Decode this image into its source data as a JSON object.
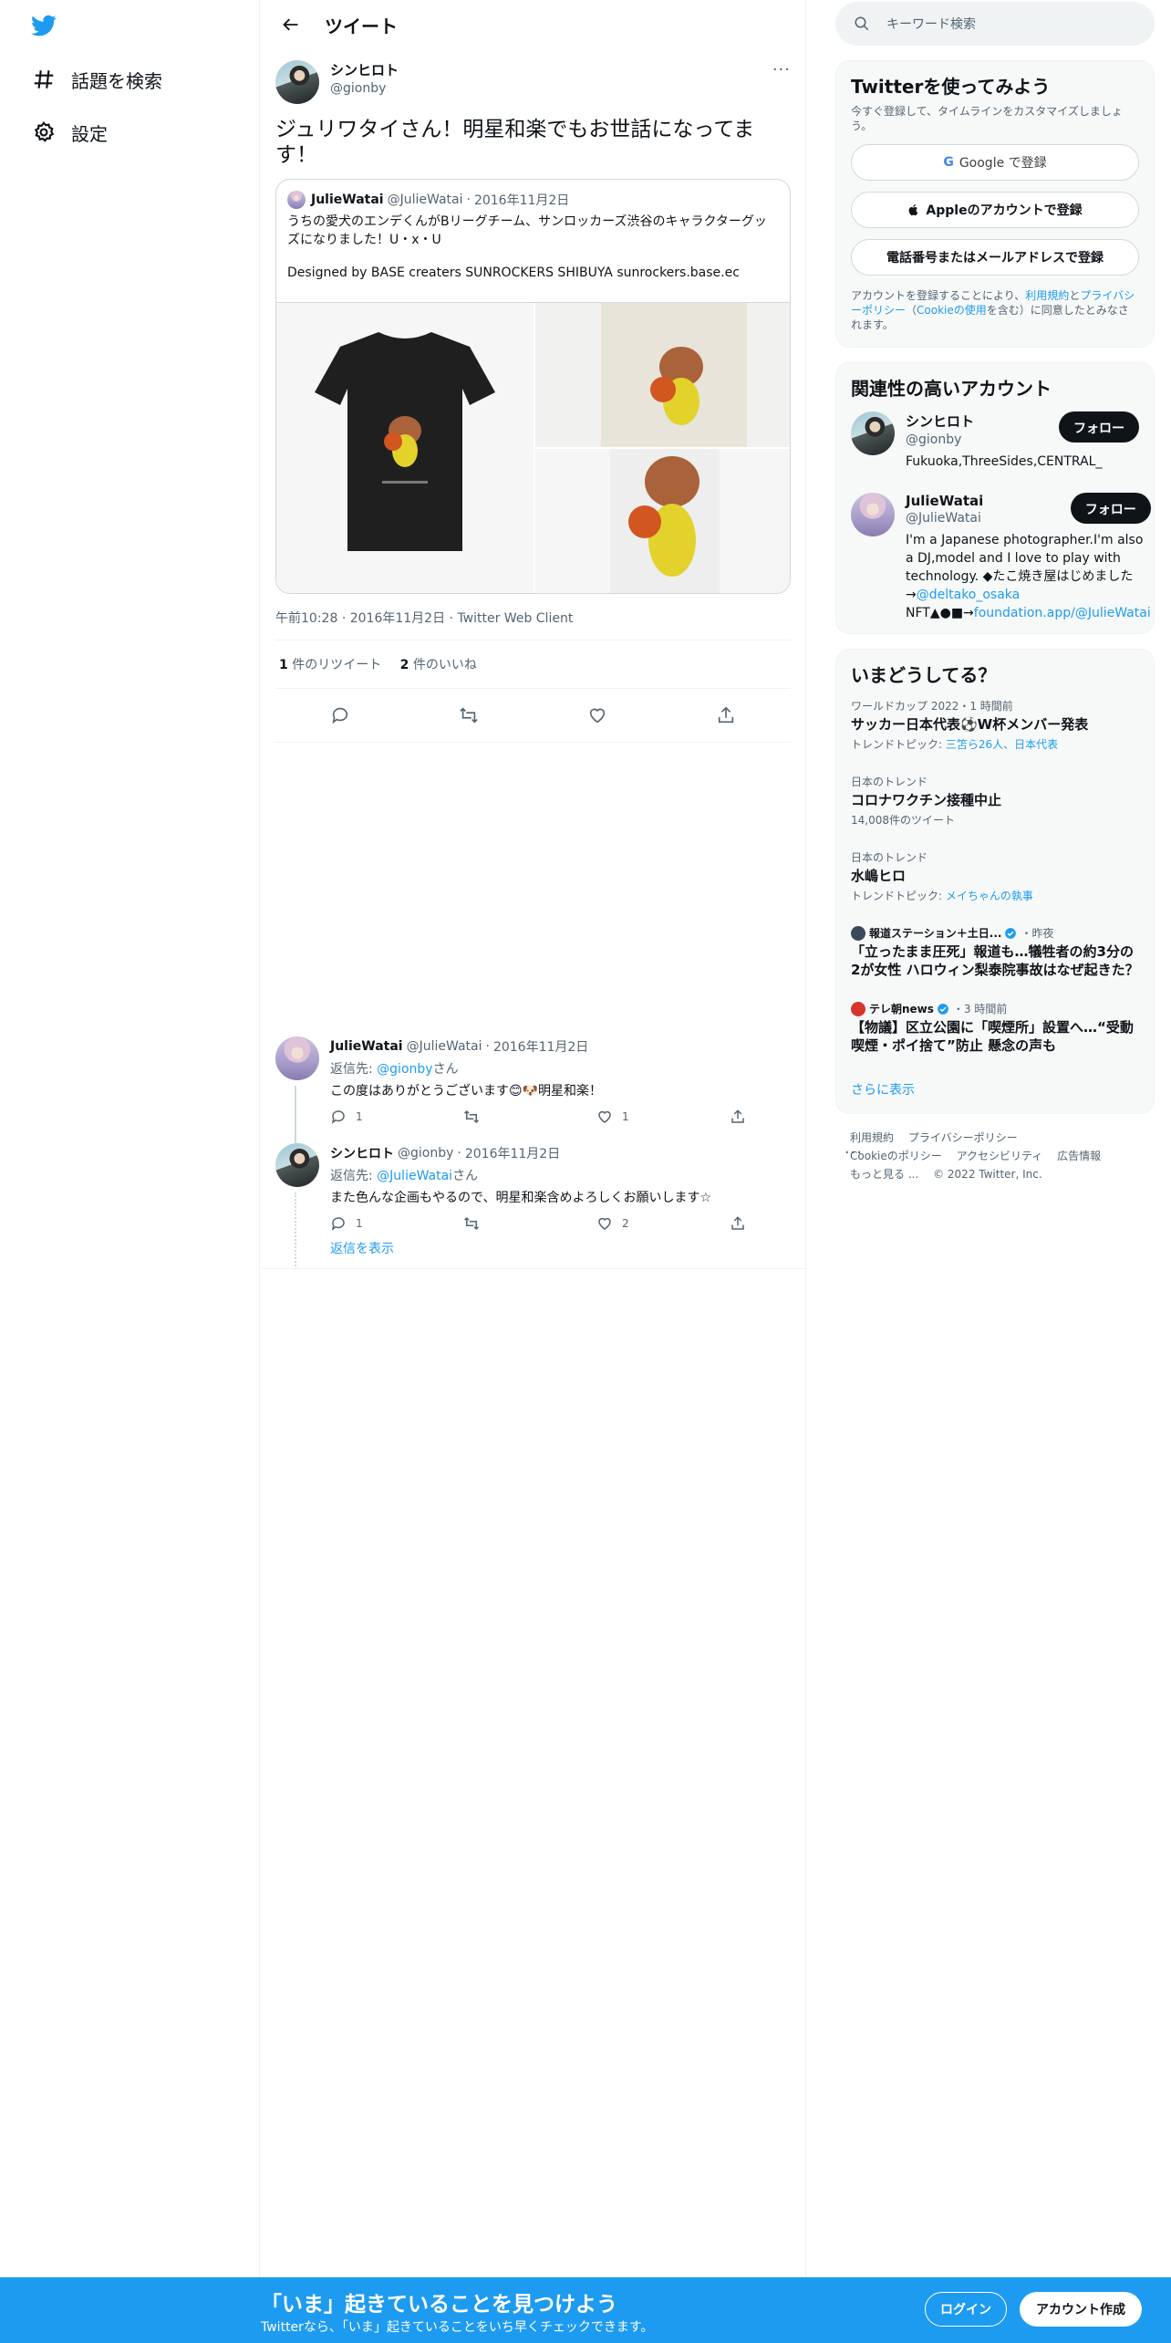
{
  "nav": {
    "explore_label": "話題を検索",
    "settings_label": "設定"
  },
  "header": {
    "title": "ツイート"
  },
  "tweet": {
    "display_name": "シンヒロト",
    "handle": "@gionby",
    "text": "ジュリワタイさん！明星和楽でもお世話になってます！",
    "quote": {
      "display_name": "JulieWatai",
      "handle": "@JulieWatai",
      "date": "2016年11月2日",
      "text_line1": "うちの愛犬のエンデくんがBリーグチーム、サンロッカーズ渋谷のキャラクターグッズになりました！U・x・U",
      "text_line2": "Designed by BASE creaters SUNROCKERS SHIBUYA sunrockers.base.ec"
    },
    "meta_time": "午前10:28",
    "meta_date": "2016年11月2日",
    "meta_client": "Twitter Web Client",
    "retweet_count": "1",
    "retweet_label": "件のリツイート",
    "like_count": "2",
    "like_label": "件のいいね"
  },
  "replies": [
    {
      "display_name": "JulieWatai",
      "handle": "@JulieWatai",
      "date": "2016年11月2日",
      "reply_to_prefix": "返信先: ",
      "reply_to_handle": "@gionby",
      "reply_to_suffix": "さん",
      "text": "この度はありがとうございます😊🐶明星和楽！",
      "reply_count": "1",
      "retweet_count": "",
      "like_count": "1"
    },
    {
      "display_name": "シンヒロト",
      "handle": "@gionby",
      "date": "2016年11月2日",
      "reply_to_prefix": "返信先: ",
      "reply_to_handle": "@JulieWatai",
      "reply_to_suffix": "さん",
      "text": "また色んな企画もやるので、明星和楽含めよろしくお願いします☆",
      "reply_count": "1",
      "retweet_count": "",
      "like_count": "2"
    }
  ],
  "show_replies_label": "返信を表示",
  "sidebar": {
    "search_placeholder": "キーワード検索",
    "signup": {
      "title": "Twitterを使ってみよう",
      "subtitle": "今すぐ登録して、タイムラインをカスタマイズしましょう。",
      "google_label": "Google で登録",
      "apple_label": "Appleのアカウントで登録",
      "phone_label": "電話番号またはメールアドレスで登録",
      "terms_prefix": "アカウントを登録することにより、",
      "terms_link": "利用規約",
      "terms_mid": "と",
      "privacy_link": "プライバシーポリシー",
      "cookie_open": "（",
      "cookie_link": "Cookieの使用",
      "terms_suffix": "を含む）に同意したとみなされます。"
    },
    "relevant": {
      "title": "関連性の高いアカウント",
      "follow_label": "フォロー",
      "accounts": [
        {
          "display_name": "シンヒロト",
          "handle": "@gionby",
          "bio": "Fukuoka,ThreeSides,CENTRAL_"
        },
        {
          "display_name": "JulieWatai",
          "handle": "@JulieWatai",
          "bio": "I'm a Japanese photographer.I'm also a DJ,model and I love to play with technology. ◆たこ焼き屋はじめました→",
          "bio_link1": "@deltako_osaka",
          "bio_mid": "NFT▲●■→",
          "bio_link2": "foundation.app/@JulieWatai"
        }
      ]
    },
    "trends": {
      "title": "いまどうしてる？",
      "items": [
        {
          "category": "ワールドカップ 2022・1 時間前",
          "title": "サッカー日本代表⚽W杯メンバー発表",
          "sub_prefix": "トレンドトピック: ",
          "sub_link": "三笘ら26人、日本代表"
        },
        {
          "category": "日本のトレンド",
          "title": "コロナワクチン接種中止",
          "sub": "14,008件のツイート"
        },
        {
          "category": "日本のトレンド",
          "title": "水嶋ヒロ",
          "sub_prefix": "トレンドトピック: ",
          "sub_link": "メイちゃんの執事"
        }
      ],
      "news": [
        {
          "source": "報道ステーション＋土日...",
          "time": "・昨夜",
          "title": "「立ったまま圧死」報道も…犠牲者の約3分の2が女性 ハロウィン梨泰院事故はなぜ起きた？"
        },
        {
          "source": "テレ朝news",
          "time": "・3 時間前",
          "title": "【物議】区立公園に「喫煙所」設置へ…“受動喫煙・ポイ捨て”防止 懸念の声も"
        }
      ],
      "more_label": "さらに表示"
    },
    "footer": {
      "terms": "利用規約",
      "privacy": "プライバシーポリシー",
      "cookie": "Cookieのポリシー",
      "accessibility": "アクセシビリティ",
      "ads": "広告情報",
      "more": "もっと見る ...",
      "copyright": "© 2022 Twitter, Inc."
    }
  },
  "bottombar": {
    "title": "「いま」起きていることを見つけよう",
    "subtitle": "Twitterなら、「いま」起きていることをいち早くチェックできます。",
    "login_label": "ログイン",
    "signup_label": "アカウント作成"
  },
  "colors": {
    "accent": "#1d9bf0",
    "text": "#0f1419",
    "muted": "#536471"
  }
}
